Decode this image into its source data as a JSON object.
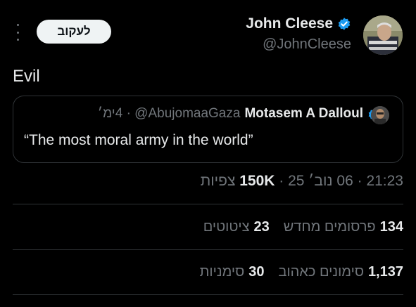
{
  "header": {
    "follow_label": "לעקוב",
    "author_name": "John Cleese",
    "author_handle": "@JohnCleese"
  },
  "tweet": {
    "text": "Evil"
  },
  "quote": {
    "author_name": "Motasem A Dalloul",
    "meta": "‏4ימ׳ · @AbujomaaGaza",
    "text": "“The most moral army in the world”"
  },
  "meta_line": {
    "time": "21:23",
    "date": "06 נוב׳ 25",
    "views_count": "150K",
    "views_label": "צפיות"
  },
  "stats": {
    "reposts_count": "134",
    "reposts_label": "פרסומים מחדש",
    "quotes_count": "23",
    "quotes_label": "ציטוטים",
    "likes_count": "1,137",
    "likes_label": "סימונים כאהוב",
    "bookmarks_count": "30",
    "bookmarks_label": "סימניות"
  },
  "colors": {
    "background": "#000000",
    "text_primary": "#e7e9ea",
    "text_secondary": "#71767b",
    "verified_blue": "#1d9bf0",
    "divider": "#2f3336"
  },
  "icons": [
    "more-vertical-icon",
    "verified-badge-icon"
  ]
}
